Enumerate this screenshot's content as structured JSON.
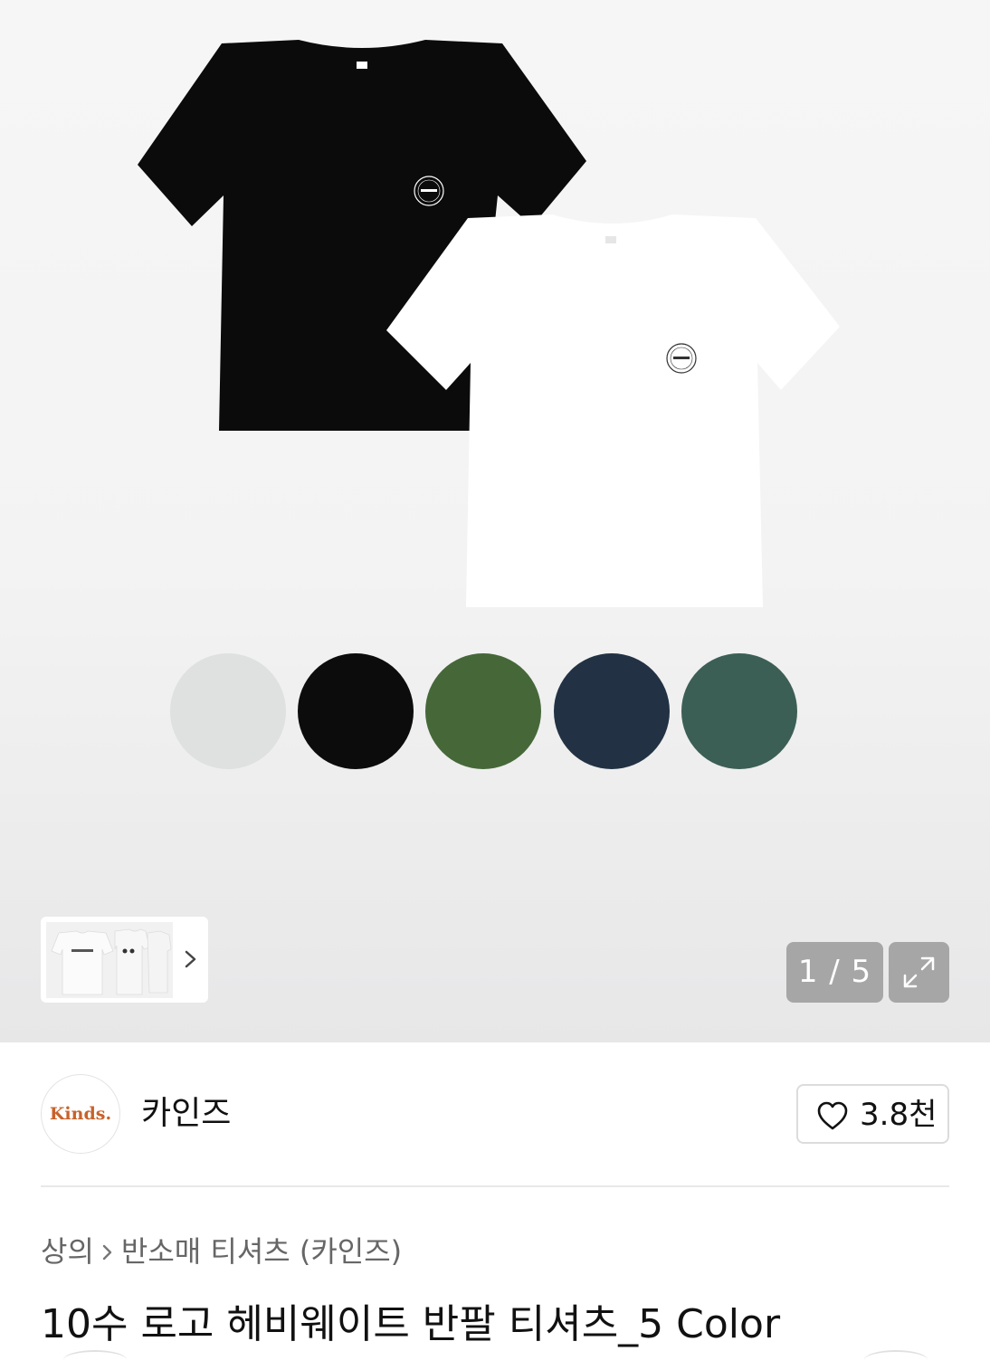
{
  "gallery": {
    "counter": "1 / 5",
    "swatch_colors": [
      "#dee1df",
      "#0c0c0c",
      "#466839",
      "#223244",
      "#3c5f55"
    ]
  },
  "brand": {
    "logo_text": "Kinds.",
    "name": "카인즈",
    "like_count": "3.8천"
  },
  "breadcrumb": {
    "category": "상의",
    "subcategory": "반소매 티셔츠 (카인즈)"
  },
  "product": {
    "title": "10수 로고 헤비웨이트 반팔 티셔츠_5 Color"
  }
}
